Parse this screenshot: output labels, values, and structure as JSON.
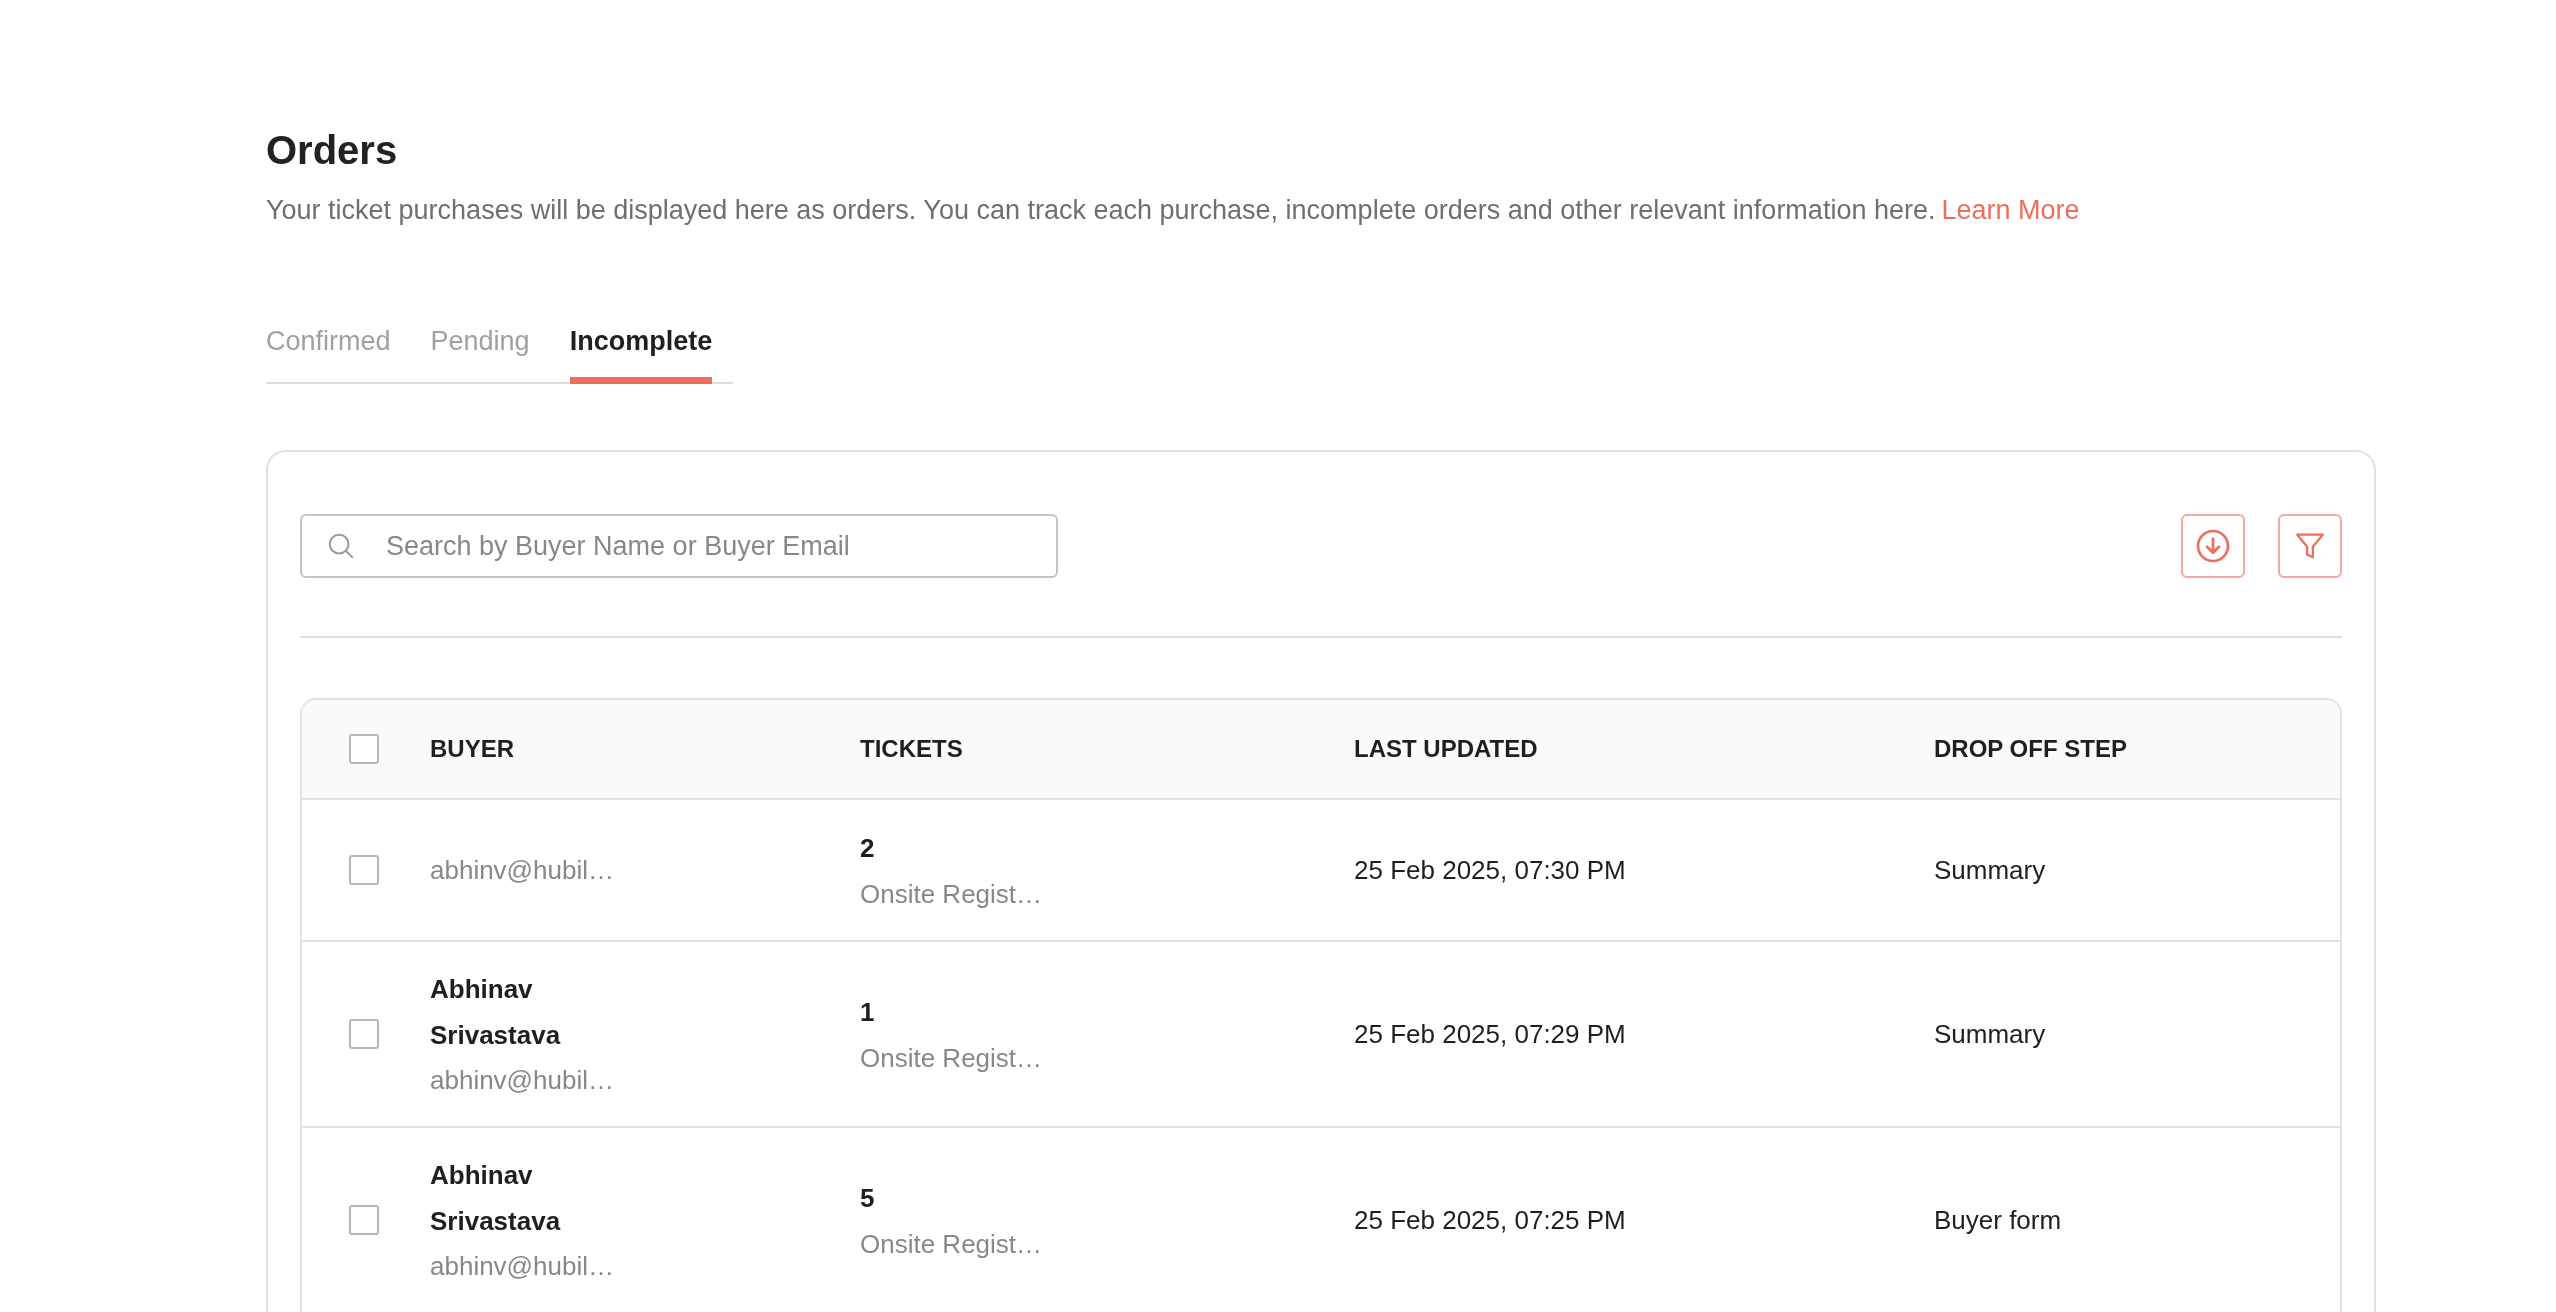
{
  "page": {
    "title": "Orders",
    "description": "Your ticket purchases will be displayed here as orders. You can track each purchase, incomplete orders and other relevant information here.",
    "link": "Learn More"
  },
  "tabs": [
    {
      "label": "Confirmed",
      "selected": false
    },
    {
      "label": "Pending",
      "selected": false
    },
    {
      "label": "Incomplete",
      "selected": true
    }
  ],
  "search": {
    "placeholder": "Search by Buyer Name or Buyer Email"
  },
  "table": {
    "select_all": {
      "checked": false
    },
    "columns": [
      "BUYER",
      "TICKETS",
      "LAST UPDATED",
      "DROP OFF STEP"
    ],
    "rows": [
      {
        "checked": false,
        "email": "abhinv@hubil…",
        "count": "2",
        "ticket": "Onsite Regist…",
        "updated": "25 Feb 2025, 07:30 PM",
        "step": "Summary"
      },
      {
        "checked": false,
        "name": "Abhinav Srivastava",
        "email": "abhinv@hubil…",
        "count": "1",
        "ticket": "Onsite Regist…",
        "updated": "25 Feb 2025, 07:29 PM",
        "step": "Summary"
      },
      {
        "checked": false,
        "name": "Abhinav Srivastava",
        "email": "abhinv@hubil…",
        "count": "5",
        "ticket": "Onsite Regist…",
        "updated": "25 Feb 2025, 07:25 PM",
        "step": "Buyer form"
      }
    ]
  }
}
